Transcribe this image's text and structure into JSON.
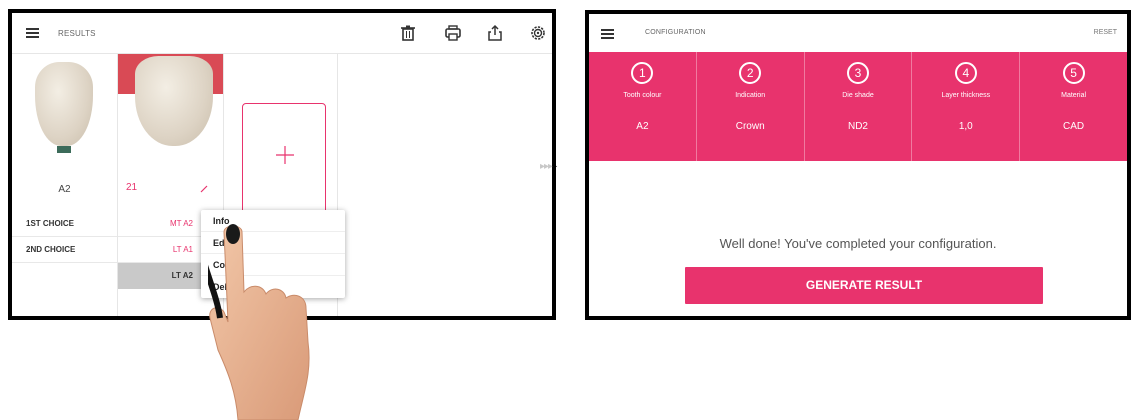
{
  "left": {
    "title": "RESULTS",
    "icons": [
      "trash-icon",
      "print-icon",
      "share-icon",
      "settings-icon"
    ],
    "card1": {
      "shade": "A2"
    },
    "card2": {
      "tooth_number": "21"
    },
    "rows": [
      {
        "label": "1ST CHOICE",
        "value": "MT A2"
      },
      {
        "label": "2ND CHOICE",
        "value": "LT A1"
      },
      {
        "label": "",
        "value": "LT A2"
      }
    ],
    "menu": [
      "Info",
      "Edit",
      "Copy",
      "Delete"
    ]
  },
  "right": {
    "title": "CONFIGURATION",
    "reset": "RESET",
    "steps": [
      {
        "num": "1",
        "title": "Tooth colour",
        "value": "A2"
      },
      {
        "num": "2",
        "title": "Indication",
        "value": "Crown"
      },
      {
        "num": "3",
        "title": "Die shade",
        "value": "ND2"
      },
      {
        "num": "4",
        "title": "Layer thickness",
        "value": "1,0"
      },
      {
        "num": "5",
        "title": "Material",
        "value": "CAD"
      }
    ],
    "message": "Well done! You've completed your configuration.",
    "button": "GENERATE RESULT"
  },
  "colors": {
    "accent": "#e8336d",
    "gum": "#d94a55"
  }
}
